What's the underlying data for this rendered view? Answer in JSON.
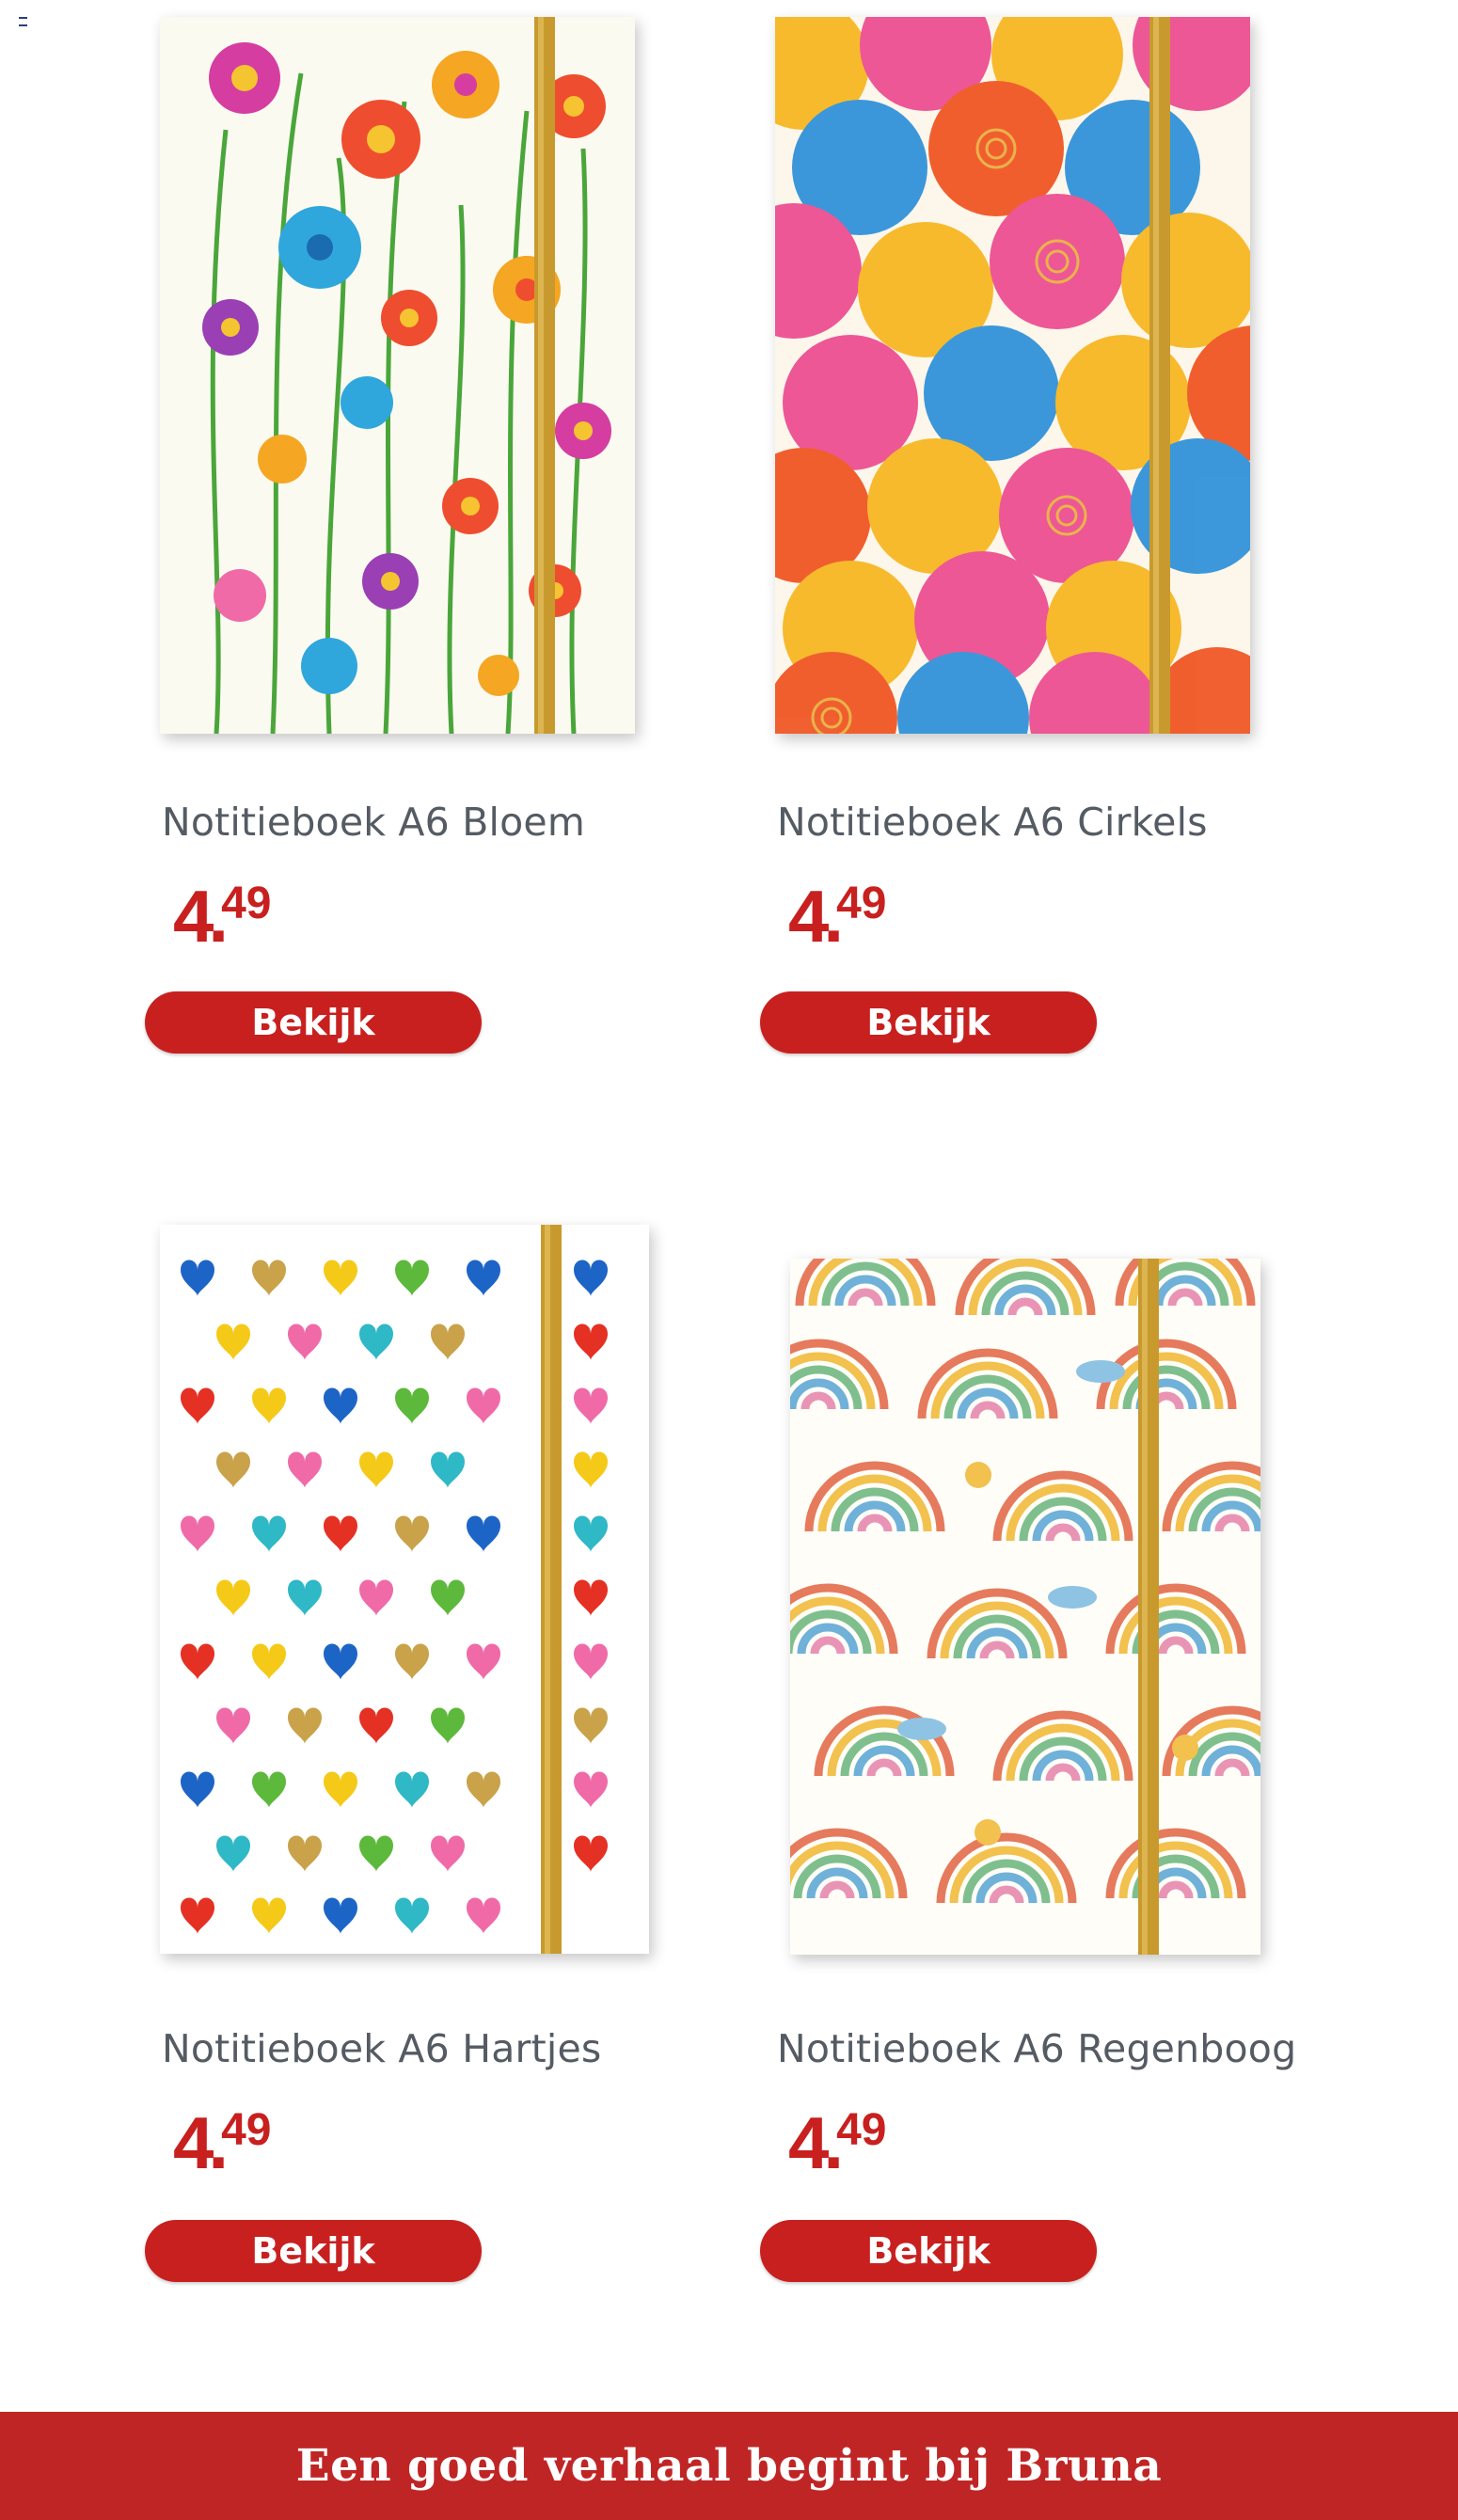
{
  "products": [
    {
      "name": "Notitieboek A6 Bloem",
      "price_whole": "4",
      "price_cents": "49",
      "button_label": "Bekijk",
      "pattern": "flowers"
    },
    {
      "name": "Notitieboek A6 Cirkels",
      "price_whole": "4",
      "price_cents": "49",
      "button_label": "Bekijk",
      "pattern": "circles"
    },
    {
      "name": "Notitieboek A6 Hartjes",
      "price_whole": "4",
      "price_cents": "49",
      "button_label": "Bekijk",
      "pattern": "hearts"
    },
    {
      "name": "Notitieboek A6 Regenboog",
      "price_whole": "4",
      "price_cents": "49",
      "button_label": "Bekijk",
      "pattern": "rainbows"
    }
  ],
  "footer": {
    "slogan": "Een goed verhaal begint bij Bruna"
  },
  "colors": {
    "brand_red": "#c8201f",
    "footer_red": "#c02525",
    "title_gray": "#555b63"
  }
}
